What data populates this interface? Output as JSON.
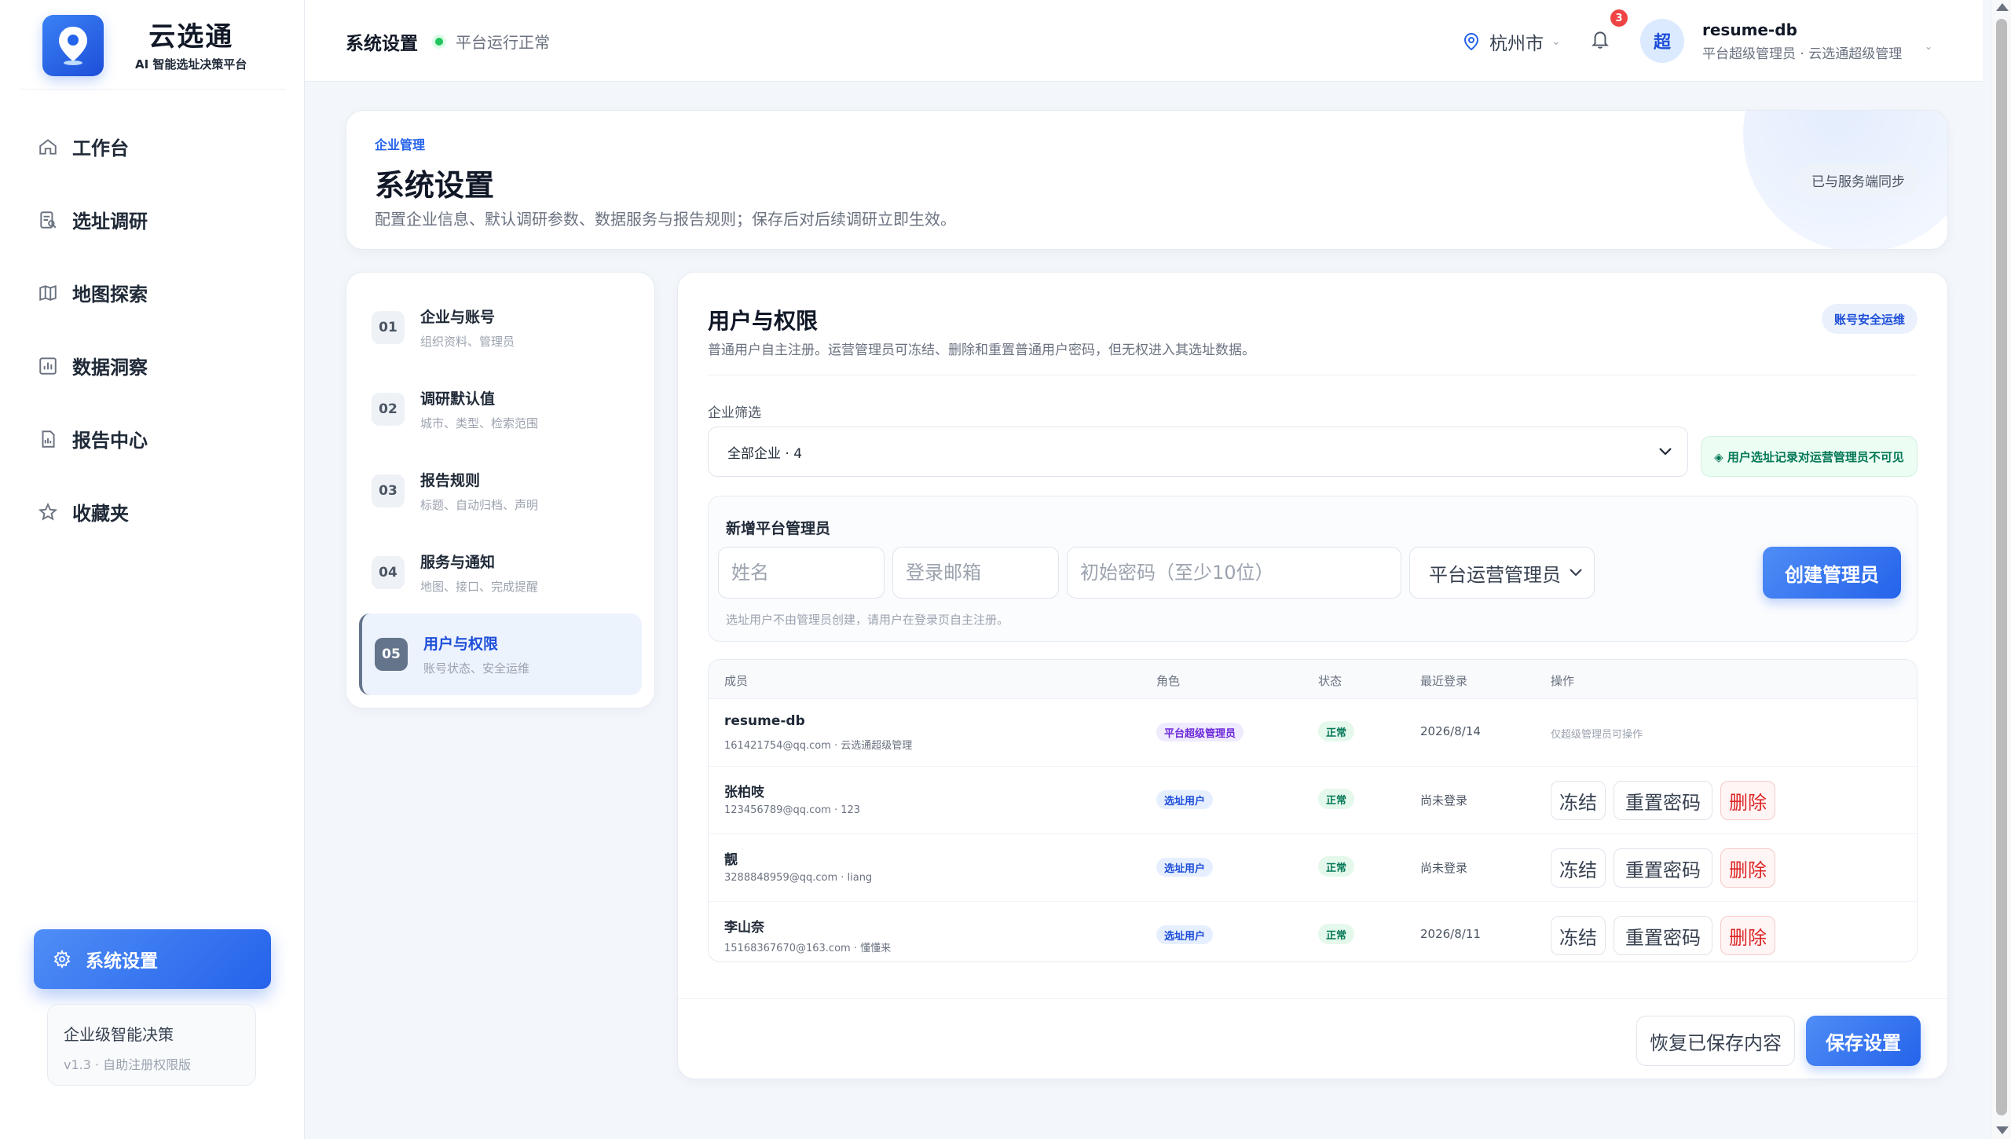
{
  "brand": {
    "name": "云选通",
    "subtitle": "AI 智能选址决策平台"
  },
  "sidebar": {
    "items": [
      {
        "label": "工作台",
        "icon": "home-icon"
      },
      {
        "label": "选址调研",
        "icon": "survey-icon"
      },
      {
        "label": "地图探索",
        "icon": "map-icon"
      },
      {
        "label": "数据洞察",
        "icon": "chart-icon"
      },
      {
        "label": "报告中心",
        "icon": "report-icon"
      },
      {
        "label": "收藏夹",
        "icon": "star-icon"
      }
    ],
    "active": {
      "label": "系统设置",
      "icon": "gear-icon"
    },
    "version": {
      "title": "企业级智能决策",
      "subtitle": "v1.3 · 自助注册权限版"
    }
  },
  "header": {
    "title": "系统设置",
    "status": "平台运行正常",
    "city": "杭州市",
    "notification_count": "3",
    "avatar_text": "超",
    "user_name": "resume-db",
    "user_role": "平台超级管理员 · 云选通超级管理"
  },
  "hero": {
    "tag": "企业管理",
    "title": "系统设置",
    "description": "配置企业信息、默认调研参数、数据服务与报告规则；保存后对后续调研立即生效。",
    "sync_badge": "已与服务端同步"
  },
  "steps": [
    {
      "num": "01",
      "title": "企业与账号",
      "sub": "组织资料、管理员"
    },
    {
      "num": "02",
      "title": "调研默认值",
      "sub": "城市、类型、检索范围"
    },
    {
      "num": "03",
      "title": "报告规则",
      "sub": "标题、自动归档、声明"
    },
    {
      "num": "04",
      "title": "服务与通知",
      "sub": "地图、接口、完成提醒"
    },
    {
      "num": "05",
      "title": "用户与权限",
      "sub": "账号状态、安全运维"
    }
  ],
  "panel": {
    "title": "用户与权限",
    "description": "普通用户自主注册。运营管理员可冻结、删除和重置普通用户密码，但无权进入其选址数据。",
    "badge": "账号安全运维",
    "filter_label": "企业筛选",
    "filter_value": "全部企业 · 4",
    "filter_note": "◈ 用户选址记录对运营管理员不可见",
    "new_admin": {
      "title": "新增平台管理员",
      "name_placeholder": "姓名",
      "email_placeholder": "登录邮箱",
      "password_placeholder": "初始密码（至少10位）",
      "role_value": "平台运营管理员",
      "create_label": "创建管理员",
      "hint": "选址用户不由管理员创建，请用户在登录页自主注册。"
    },
    "table": {
      "columns": [
        "成员",
        "角色",
        "状态",
        "最近登录",
        "操作"
      ],
      "rows": [
        {
          "name": "resume-db",
          "email": "161421754@qq.com · 云选通超级管理",
          "role": "平台超级管理员",
          "status": "正常",
          "last_login": "2026/8/14",
          "note": "仅超级管理员可操作"
        },
        {
          "name": "张柏吱",
          "email": "123456789@qq.com · 123",
          "role": "选址用户",
          "status": "正常",
          "last_login": "尚未登录"
        },
        {
          "name": "靓",
          "email": "3288848959@qq.com · liang",
          "role": "选址用户",
          "status": "正常",
          "last_login": "尚未登录"
        },
        {
          "name": "李山奈",
          "email": "15168367670@163.com · 懂懂来",
          "role": "选址用户",
          "status": "正常",
          "last_login": "2026/8/11"
        }
      ],
      "actions": {
        "freeze": "冻结",
        "reset": "重置密码",
        "delete": "删除"
      }
    },
    "footer": {
      "restore": "恢复已保存内容",
      "save": "保存设置"
    }
  }
}
